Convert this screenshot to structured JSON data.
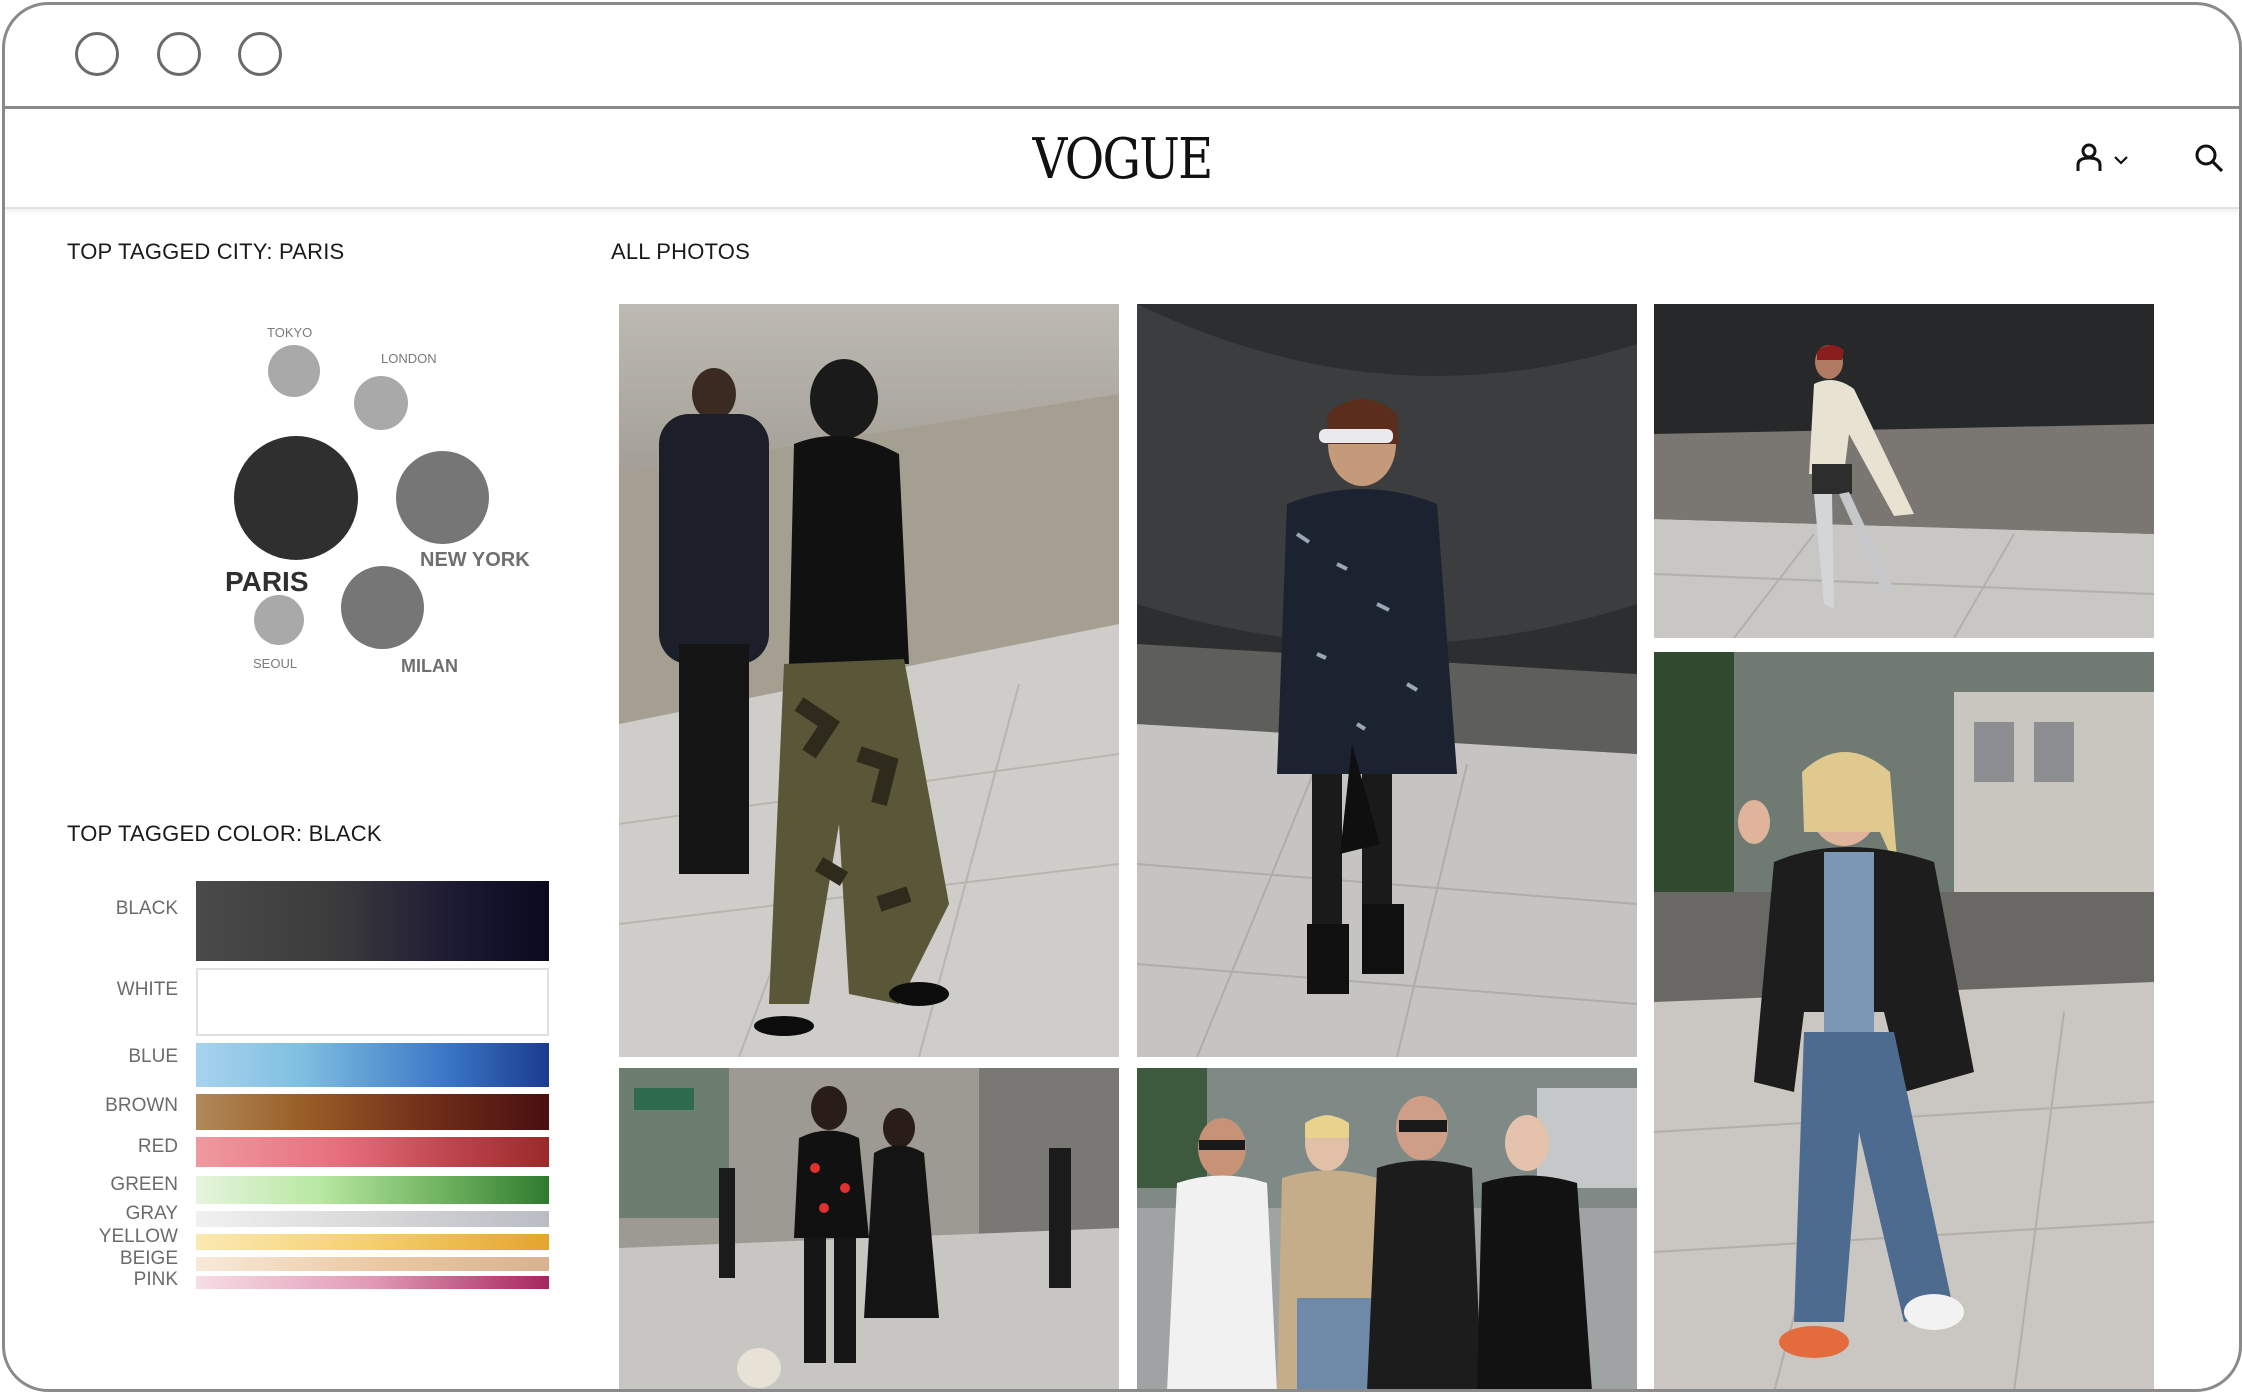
{
  "window": {
    "controls": [
      "circle",
      "circle",
      "circle"
    ]
  },
  "header": {
    "logo": "VOGUE",
    "account_icon": "user-icon",
    "dropdown_icon": "chevron-down-icon",
    "search_icon": "search-icon"
  },
  "sidebar": {
    "city_title": "TOP TAGGED CITY: PARIS",
    "cities": [
      {
        "name": "TOKYO",
        "color": "#a9a9a9"
      },
      {
        "name": "LONDON",
        "color": "#a9a9a9"
      },
      {
        "name": "PARIS",
        "color": "#2f2f2f"
      },
      {
        "name": "NEW YORK",
        "color": "#767676"
      },
      {
        "name": "MILAN",
        "color": "#767676"
      },
      {
        "name": "SEOUL",
        "color": "#a9a9a9"
      }
    ],
    "color_title": "TOP TAGGED COLOR: BLACK",
    "colors": [
      {
        "name": "BLACK",
        "from": "#4a4a4a",
        "to": "#0b0a1e"
      },
      {
        "name": "WHITE",
        "from": "#ffffff",
        "to": "#ffffff"
      },
      {
        "name": "BLUE",
        "from": "#a8d3ee",
        "to": "#1c3b8f"
      },
      {
        "name": "BROWN",
        "from": "#b08a5a",
        "to": "#4a0f0f"
      },
      {
        "name": "RED",
        "from": "#ef9aa0",
        "to": "#9a2a2a"
      },
      {
        "name": "GREEN",
        "from": "#e6f4df",
        "to": "#2f7a2e"
      },
      {
        "name": "GRAY",
        "from": "#f1f1f1",
        "to": "#b9bcc4"
      },
      {
        "name": "YELLOW",
        "from": "#fbe9b3",
        "to": "#e3a52e"
      },
      {
        "name": "BEIGE",
        "from": "#f8ead8",
        "to": "#d9b28f"
      },
      {
        "name": "PINK",
        "from": "#f6dde5",
        "to": "#a6265e"
      }
    ]
  },
  "main": {
    "title": "ALL PHOTOS",
    "photos": [
      {
        "name": "photo-camo-pants"
      },
      {
        "name": "photo-tweed-jacket"
      },
      {
        "name": "photo-silver-boots"
      },
      {
        "name": "photo-denim-wave"
      },
      {
        "name": "photo-couple-walking"
      },
      {
        "name": "photo-group-four"
      }
    ]
  }
}
